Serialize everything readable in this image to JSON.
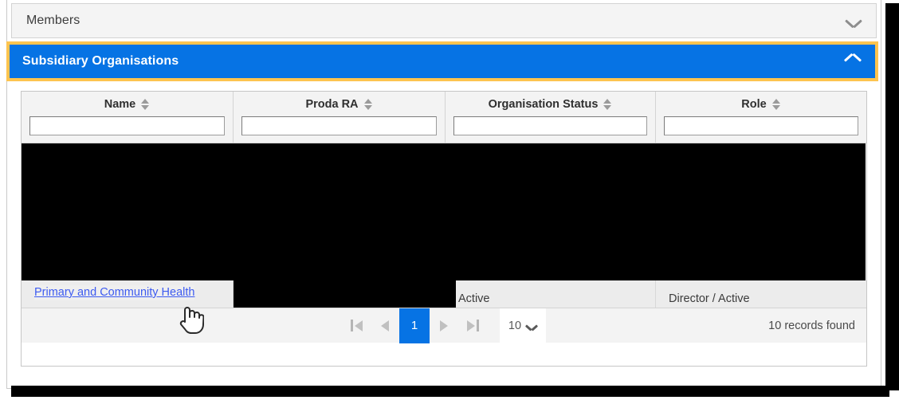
{
  "accordions": [
    {
      "id": "members",
      "label": "Members",
      "expanded": false,
      "chevron_icon": "chevron-down-icon"
    },
    {
      "id": "subsidiary-organisations",
      "label": "Subsidiary Organisations",
      "expanded": true,
      "chevron_icon": "chevron-up-icon",
      "highlight_color": "#fdc44f",
      "header_color": "#0673e4"
    }
  ],
  "grid": {
    "columns": [
      {
        "label": "Name",
        "sort_icon": "sort-arrows-icon",
        "filter_value": "",
        "filter_placeholder": ""
      },
      {
        "label": "Proda RA",
        "sort_icon": "sort-arrows-icon",
        "filter_value": "",
        "filter_placeholder": ""
      },
      {
        "label": "Organisation Status",
        "sort_icon": "sort-arrows-icon",
        "filter_value": "",
        "filter_placeholder": ""
      },
      {
        "label": "Role",
        "sort_icon": "sort-arrows-icon",
        "filter_value": "",
        "filter_placeholder": ""
      }
    ],
    "visible_row": {
      "name": "Primary and Community Health",
      "proda_ra": "",
      "organisation_status": "Active",
      "role": "Director / Active"
    }
  },
  "pager": {
    "first_icon": "first-page-icon",
    "prev_icon": "previous-page-icon",
    "current_page": "1",
    "next_icon": "next-page-icon",
    "last_icon": "last-page-icon",
    "page_size": "10",
    "page_size_chevron": "chevron-down-icon",
    "records_found": "10 records found"
  },
  "cursor": {
    "icon": "hand-pointer-cursor"
  }
}
